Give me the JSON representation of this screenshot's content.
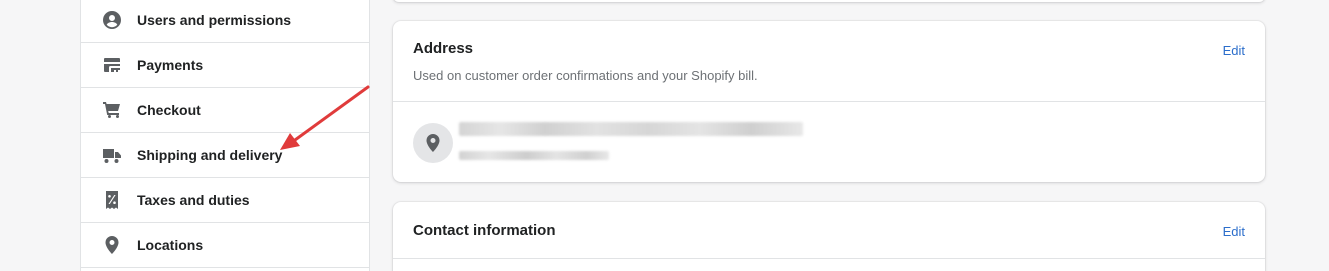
{
  "sidebar": {
    "items": [
      {
        "label": "Users and permissions",
        "icon": "user-circle-icon"
      },
      {
        "label": "Payments",
        "icon": "payments-icon"
      },
      {
        "label": "Checkout",
        "icon": "cart-icon"
      },
      {
        "label": "Shipping and delivery",
        "icon": "truck-icon"
      },
      {
        "label": "Taxes and duties",
        "icon": "tax-receipt-icon"
      },
      {
        "label": "Locations",
        "icon": "location-pin-icon"
      }
    ]
  },
  "address_card": {
    "title": "Address",
    "subtitle": "Used on customer order confirmations and your Shopify bill.",
    "edit_label": "Edit",
    "icon": "location-pin-icon"
  },
  "contact_card": {
    "title": "Contact information",
    "edit_label": "Edit"
  },
  "colors": {
    "accent": "#2c6ecb",
    "annotation_arrow": "#e03b3b",
    "background": "#f6f6f7"
  }
}
